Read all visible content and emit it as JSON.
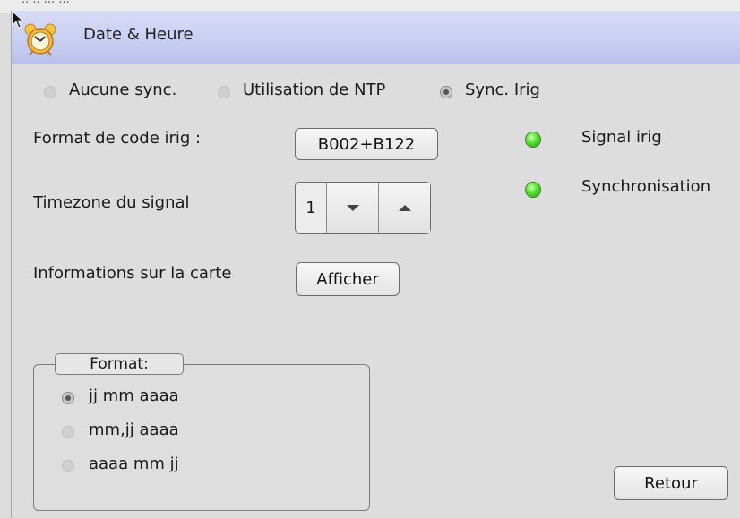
{
  "window": {
    "title": "Date & Heure",
    "icon": "alarm-clock-icon"
  },
  "background_fragment": "·· ·· ··· ···",
  "sync_mode": {
    "options": [
      {
        "label": "Aucune sync.",
        "selected": false
      },
      {
        "label": "Utilisation de NTP",
        "selected": false
      },
      {
        "label": "Sync. Irig",
        "selected": true
      }
    ]
  },
  "irig": {
    "format_label": "Format de code irig :",
    "format_value": "B002+B122",
    "timezone_label": "Timezone du signal",
    "timezone_value": "1"
  },
  "card_info": {
    "label": "Informations sur la carte",
    "button": "Afficher"
  },
  "indicators": [
    {
      "label": "Signal irig",
      "color": "#3fd62a"
    },
    {
      "label": "Synchronisation",
      "color": "#3fd62a"
    }
  ],
  "date_format": {
    "legend": "Format:",
    "options": [
      {
        "label": "jj mm aaaa",
        "selected": true
      },
      {
        "label": "mm,jj aaaa",
        "selected": false
      },
      {
        "label": "aaaa mm jj",
        "selected": false
      }
    ]
  },
  "buttons": {
    "back": "Retour"
  }
}
